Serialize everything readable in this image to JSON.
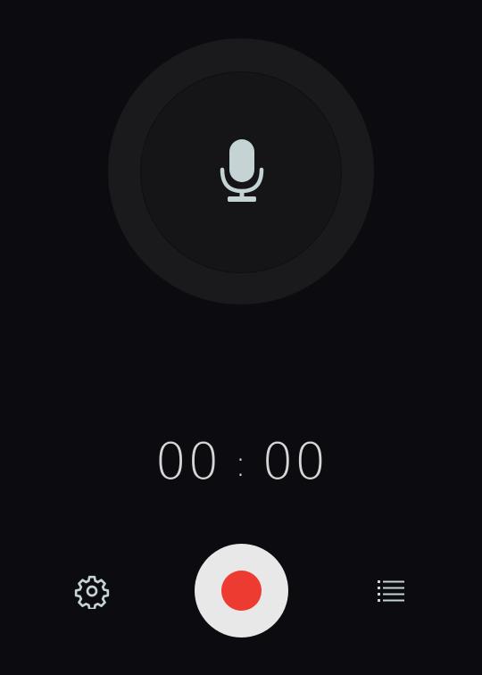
{
  "timer": {
    "minutes": "00",
    "separator": ":",
    "seconds": "00"
  },
  "icons": {
    "mic": "microphone-icon",
    "settings": "gear-icon",
    "record": "record-icon",
    "list": "list-icon"
  },
  "colors": {
    "background": "#0c0b10",
    "record_button": "#e8e8e8",
    "record_dot": "#ee3b31",
    "mic_icon": "#c5d3d4",
    "text": "#d6d6d6"
  }
}
